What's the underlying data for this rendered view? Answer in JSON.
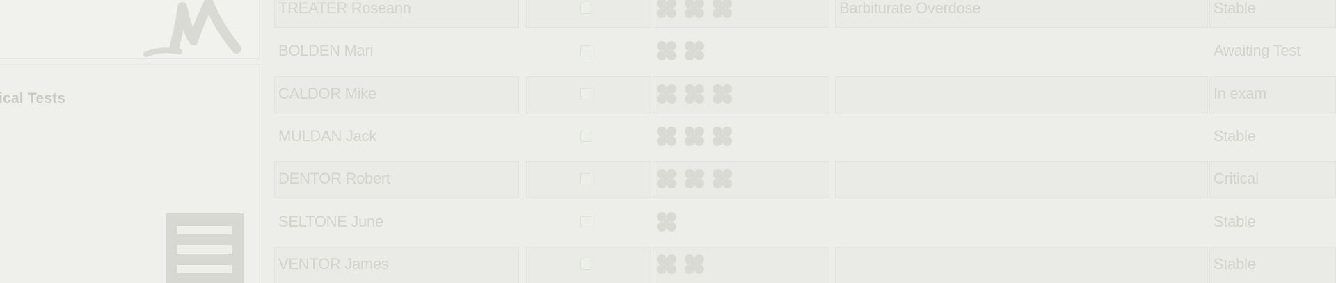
{
  "sidebar": {
    "section_label": "ical Tests",
    "logo_icon": "brand-logo-icon",
    "menu_icon": "list-icon"
  },
  "patients": [
    {
      "name": "TREATER Roseann",
      "checked": false,
      "triage_level": 3,
      "diagnosis": "Barbiturate Overdose",
      "status": "Stable"
    },
    {
      "name": "BOLDEN Mari",
      "checked": false,
      "triage_level": 2,
      "diagnosis": "",
      "status": "Awaiting Test"
    },
    {
      "name": "CALDOR Mike",
      "checked": false,
      "triage_level": 3,
      "diagnosis": "",
      "status": "In exam"
    },
    {
      "name": "MULDAN Jack",
      "checked": false,
      "triage_level": 3,
      "diagnosis": "",
      "status": "Stable"
    },
    {
      "name": "DENTOR Robert",
      "checked": false,
      "triage_level": 3,
      "diagnosis": "",
      "status": "Critical"
    },
    {
      "name": "SELTONE June",
      "checked": false,
      "triage_level": 1,
      "diagnosis": "",
      "status": "Stable"
    },
    {
      "name": "VENTOR James",
      "checked": false,
      "triage_level": 2,
      "diagnosis": "",
      "status": "Stable"
    }
  ],
  "colors": {
    "background": "#edeee9",
    "cell": "#eaebe6",
    "faded_text": "#d3d4ce",
    "icon": "#d7d8d2"
  }
}
